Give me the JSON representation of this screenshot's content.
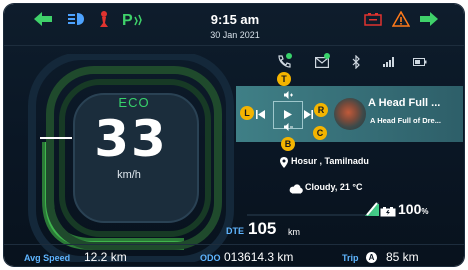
{
  "header": {
    "time": "9:15 am",
    "date": "30 Jan 2021",
    "left_icons": [
      "left-turn-signal-icon",
      "headlight-icon",
      "side-stand-icon",
      "parking-icon"
    ],
    "right_icons": [
      "battery-warning-icon",
      "hazard-warning-icon",
      "right-turn-signal-icon"
    ]
  },
  "status_icons": [
    "phone-call-icon",
    "message-icon",
    "bluetooth-icon",
    "signal-strength-icon",
    "phone-battery-icon"
  ],
  "gauge": {
    "mode": "ECO",
    "speed": "33",
    "unit": "km/h"
  },
  "media": {
    "song_title": "A Head Full ...",
    "album": "A Head Full of Dre...",
    "controls": [
      "previous-icon",
      "play-icon",
      "next-icon",
      "volume-up-icon",
      "volume-down-icon"
    ],
    "callouts": {
      "top": "T",
      "left": "L",
      "right": "R",
      "bottom": "B",
      "center": "C"
    }
  },
  "location": {
    "place": "Hosur , Tamilnadu",
    "weather": "Cloudy, 21 °C"
  },
  "range": {
    "battery_percent": "100",
    "percent_sign": "%",
    "dte_label": "DTE",
    "dte_value": "105",
    "dte_unit": "km"
  },
  "footer": {
    "avg_speed_label": "Avg Speed",
    "avg_speed_value": "12.2 km",
    "odo_label": "ODO",
    "odo_value": "013614.3 km",
    "trip_label": "Trip",
    "trip_id": "A",
    "trip_value": "85 km"
  },
  "colors": {
    "accent_green": "#37d26b",
    "label_blue": "#5fb5ff",
    "warning_red": "#e0332f",
    "warning_yellow": "#f4b400"
  }
}
